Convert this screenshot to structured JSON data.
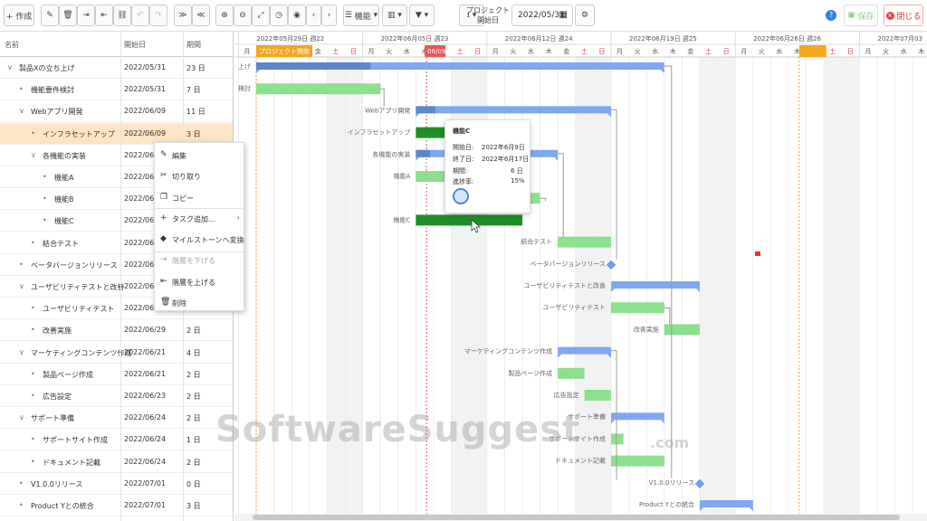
{
  "toolbar": {
    "create_label": "+ 作成",
    "filter_label": "機能",
    "project_start_label": "プロジェクト開始日",
    "project_start_value": "2022/05/31",
    "save_label": "保存",
    "close_label": "閉じる"
  },
  "grid": {
    "headers": {
      "name": "名前",
      "start": "開始日",
      "duration": "期間"
    },
    "rows": [
      {
        "name": "製品Xの立ち上げ",
        "start": "2022/05/31",
        "duration": "23 日",
        "twisty": "∨"
      },
      {
        "name": "機能要件検討",
        "start": "2022/05/31",
        "duration": "7 日",
        "twisty": "•"
      },
      {
        "name": "Webアプリ開発",
        "start": "2022/06/09",
        "duration": "11 日",
        "twisty": "∨"
      },
      {
        "name": "インフラセットアップ",
        "start": "2022/06/09",
        "duration": "3 日",
        "twisty": "•"
      },
      {
        "name": "各機能の実装",
        "start": "2022/06/",
        "duration": "",
        "twisty": "∨"
      },
      {
        "name": "機能A",
        "start": "2022/06/",
        "duration": "",
        "twisty": "•"
      },
      {
        "name": "機能B",
        "start": "2022/06/",
        "duration": "",
        "twisty": "•"
      },
      {
        "name": "機能C",
        "start": "2022/06/",
        "duration": "",
        "twisty": "•"
      },
      {
        "name": "結合テスト",
        "start": "2022/06/2",
        "duration": "",
        "twisty": "•"
      },
      {
        "name": "ベータバージョンリリース",
        "start": "2022/06/2",
        "duration": "",
        "twisty": "•"
      },
      {
        "name": "ユーザビリティテストと改善",
        "start": "2022/06/2",
        "duration": "",
        "twisty": "∨"
      },
      {
        "name": "ユーザビリティテスト",
        "start": "2022/06/2",
        "duration": "",
        "twisty": "•"
      },
      {
        "name": "改善実施",
        "start": "2022/06/29",
        "duration": "2 日",
        "twisty": "•"
      },
      {
        "name": "マーケティングコンテンツ作成",
        "start": "2022/06/21",
        "duration": "4 日",
        "twisty": "∨"
      },
      {
        "name": "製品ページ作成",
        "start": "2022/06/21",
        "duration": "2 日",
        "twisty": "•"
      },
      {
        "name": "広告設定",
        "start": "2022/06/23",
        "duration": "2 日",
        "twisty": "•"
      },
      {
        "name": "サポート準備",
        "start": "2022/06/24",
        "duration": "2 日",
        "twisty": "∨"
      },
      {
        "name": "サポートサイト作成",
        "start": "2022/06/24",
        "duration": "1 日",
        "twisty": "•"
      },
      {
        "name": "ドキュメント記載",
        "start": "2022/06/24",
        "duration": "2 日",
        "twisty": "•"
      },
      {
        "name": "V1.0.0リリース",
        "start": "2022/07/01",
        "duration": "0 日",
        "twisty": "•"
      },
      {
        "name": "Product Yとの統合",
        "start": "2022/07/01",
        "duration": "3 日",
        "twisty": "•"
      }
    ]
  },
  "context_menu": {
    "items": [
      {
        "icon": "✎",
        "label": "編集",
        "disabled": false
      },
      {
        "icon": "✂",
        "label": "切り取り",
        "disabled": false
      },
      {
        "icon": "❐",
        "label": "コピー",
        "disabled": false
      },
      {
        "icon": "+",
        "label": "タスク追加...",
        "disabled": false,
        "arrow": "›"
      },
      {
        "icon": "◆",
        "label": "マイルストーンへ変換",
        "disabled": false
      },
      {
        "icon": "⇥",
        "label": "階層を下げる",
        "disabled": true
      },
      {
        "icon": "⇤",
        "label": "階層を上げる",
        "disabled": false
      },
      {
        "icon": "🗑",
        "label": "削除",
        "disabled": false
      }
    ]
  },
  "timeline": {
    "weeks": [
      "2022年05月29日 週22",
      "2022年06月05日 週23",
      "2022年06月12日 週24",
      "2022年06月19日 週25",
      "2022年06月26日 週26",
      "2022年07月03"
    ],
    "days": [
      "月",
      "火",
      "水",
      "木",
      "金",
      "土",
      "日"
    ],
    "project_start_flag": "プロジェクト開始",
    "today_flag": "06/09",
    "tasks": [
      {
        "label": "上げ",
        "kind": "summary",
        "start": 0,
        "end": 23,
        "progress": 0.28
      },
      {
        "label": "検討",
        "kind": "task",
        "start": 0,
        "end": 7
      },
      {
        "label": "Webアプリ開発",
        "kind": "summary",
        "start": 9,
        "end": 20,
        "progress": 0.1
      },
      {
        "label": "インフラセットアップ",
        "kind": "taskdark",
        "start": 9,
        "end": 12
      },
      {
        "label": "各機能の実装",
        "kind": "summary",
        "start": 9,
        "end": 17,
        "progress": 0.1
      },
      {
        "label": "機能A",
        "kind": "task",
        "start": 9,
        "end": 14
      },
      {
        "label": "",
        "kind": "task",
        "start": 14,
        "end": 16
      },
      {
        "label": "機能C",
        "kind": "taskdark",
        "start": 9,
        "end": 15
      },
      {
        "label": "結合テスト",
        "kind": "task",
        "start": 17,
        "end": 20
      },
      {
        "label": "ベータバージョンリリース",
        "kind": "milestone",
        "start": 20,
        "end": 20
      },
      {
        "label": "ユーザビリティテストと改善",
        "kind": "summary",
        "start": 20,
        "end": 25,
        "progress": 0
      },
      {
        "label": "ユーザビリティテスト",
        "kind": "task",
        "start": 20,
        "end": 23
      },
      {
        "label": "改善実施",
        "kind": "task",
        "start": 23,
        "end": 25
      },
      {
        "label": "マーケティングコンテンツ作成",
        "kind": "summary",
        "start": 17,
        "end": 20,
        "progress": 0
      },
      {
        "label": "製品ページ作成",
        "kind": "task",
        "start": 17,
        "end": 18.5
      },
      {
        "label": "広告設定",
        "kind": "task",
        "start": 18.5,
        "end": 20
      },
      {
        "label": "サポート準備",
        "kind": "summary",
        "start": 20,
        "end": 23,
        "progress": 0
      },
      {
        "label": "サポートサイト作成",
        "kind": "task",
        "start": 20,
        "end": 20.7
      },
      {
        "label": "ドキュメント記載",
        "kind": "task",
        "start": 20,
        "end": 23
      },
      {
        "label": "V1.0.0リリース",
        "kind": "milestone",
        "start": 25,
        "end": 25
      },
      {
        "label": "Product Yとの統合",
        "kind": "summary",
        "start": 25,
        "end": 28,
        "progress": 0
      }
    ]
  },
  "tooltip": {
    "title": "機能C",
    "start_label": "開始日:",
    "start_value": "2022年6月9日",
    "end_label": "終了日:",
    "end_value": "2022年6月17日",
    "dur_label": "期間:",
    "dur_value": "6 日",
    "prog_label": "進捗率:",
    "prog_value": "15%"
  },
  "watermark": {
    "text": "SoftwareSuggest",
    "suffix": ".com"
  },
  "colors": {
    "summary": "#7fa8f0",
    "summary_done": "#5b86cc",
    "task": "#8de08e",
    "task_done": "#1f8f28",
    "selected": "#fde4c4",
    "milestone": "#6aa0f0",
    "weekend": "#f2f2f2"
  }
}
